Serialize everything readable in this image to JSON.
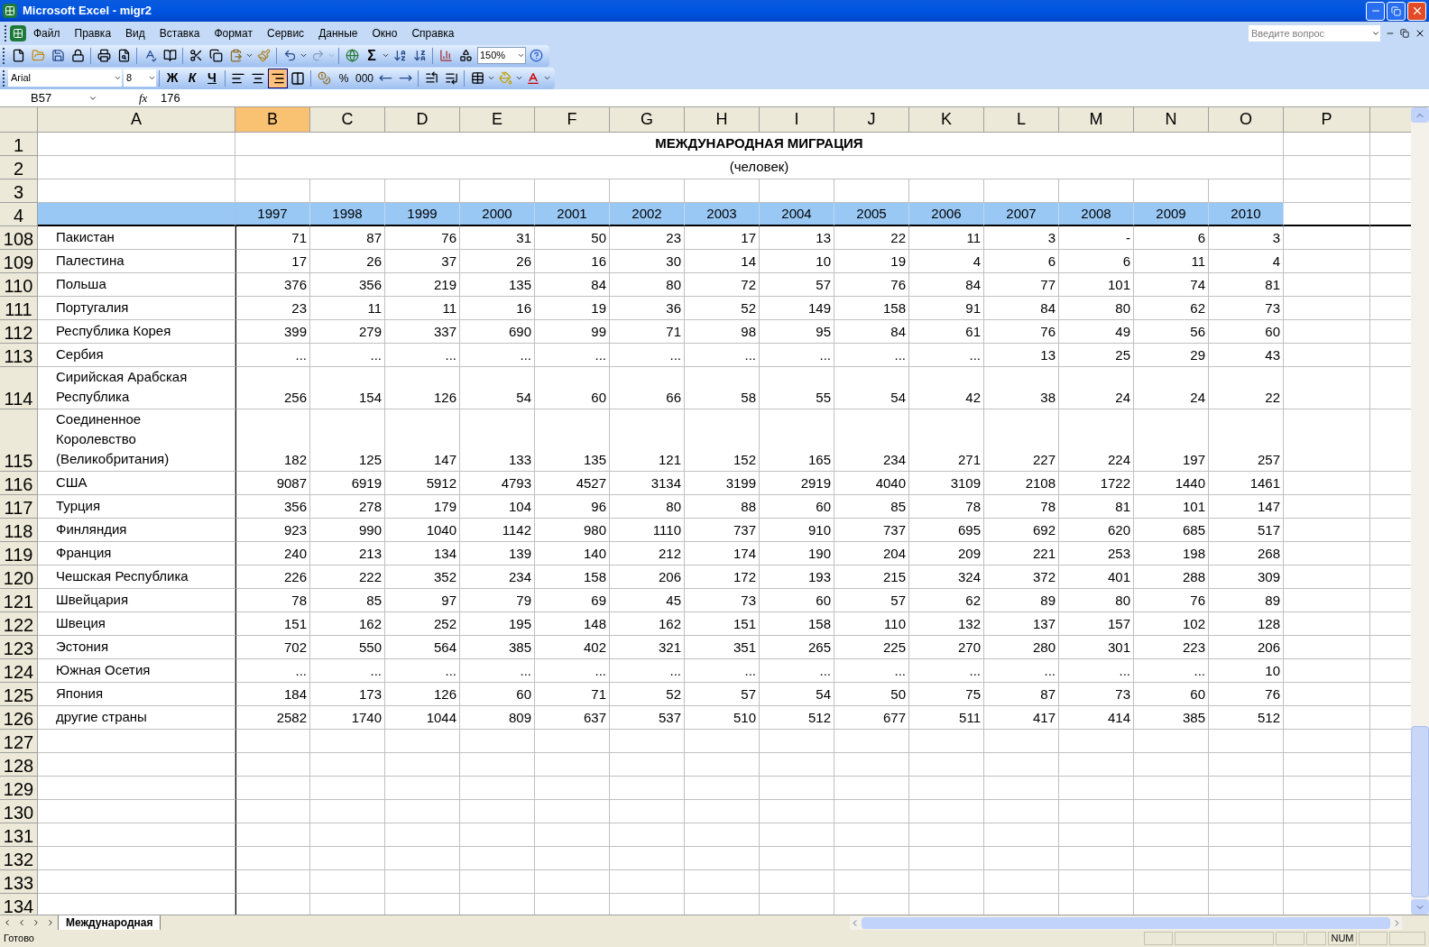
{
  "window": {
    "title": "Microsoft Excel - migr2"
  },
  "menu": [
    "Файл",
    "Правка",
    "Вид",
    "Вставка",
    "Формат",
    "Сервис",
    "Данные",
    "Окно",
    "Справка"
  ],
  "help": {
    "placeholder": "Введите вопрос"
  },
  "toolbar": {
    "sigma": "Σ",
    "zoom": "150%"
  },
  "format_bar": {
    "font": "Arial",
    "size": "8",
    "styles": [
      "Ж",
      "К",
      "Ч"
    ],
    "align": [
      {
        "kind": "left",
        "selected": false
      },
      {
        "kind": "center",
        "selected": false
      },
      {
        "kind": "right",
        "selected": true
      },
      {
        "kind": "merge",
        "selected": false
      }
    ],
    "number": [
      "%",
      "000"
    ]
  },
  "formula_bar": {
    "cell": "B57",
    "fx": "fx",
    "value": "176"
  },
  "columns": [
    {
      "label": "A",
      "selected": false
    },
    {
      "label": "B",
      "selected": true
    },
    {
      "label": "C",
      "selected": false
    },
    {
      "label": "D",
      "selected": false
    },
    {
      "label": "E",
      "selected": false
    },
    {
      "label": "F",
      "selected": false
    },
    {
      "label": "G",
      "selected": false
    },
    {
      "label": "H",
      "selected": false
    },
    {
      "label": "I",
      "selected": false
    },
    {
      "label": "J",
      "selected": false
    },
    {
      "label": "K",
      "selected": false
    },
    {
      "label": "L",
      "selected": false
    },
    {
      "label": "M",
      "selected": false
    },
    {
      "label": "N",
      "selected": false
    },
    {
      "label": "O",
      "selected": false
    },
    {
      "label": "P",
      "selected": false
    }
  ],
  "title_row": {
    "row": "1",
    "text": "МЕЖДУНАРОДНАЯ МИГРАЦИЯ"
  },
  "subtitle_row": {
    "row": "2",
    "text": "(человек)"
  },
  "blank_row": {
    "row": "3"
  },
  "year_row": {
    "row": "4",
    "years": [
      "1997",
      "1998",
      "1999",
      "2000",
      "2001",
      "2002",
      "2003",
      "2004",
      "2005",
      "2006",
      "2007",
      "2008",
      "2009",
      "2010"
    ]
  },
  "rows": [
    {
      "row": "108",
      "name": "Пакистан",
      "values": [
        "71",
        "87",
        "76",
        "31",
        "50",
        "23",
        "17",
        "13",
        "22",
        "11",
        "3",
        "-",
        "6",
        "3"
      ]
    },
    {
      "row": "109",
      "name": "Палестина",
      "values": [
        "17",
        "26",
        "37",
        "26",
        "16",
        "30",
        "14",
        "10",
        "19",
        "4",
        "6",
        "6",
        "11",
        "4"
      ]
    },
    {
      "row": "110",
      "name": "Польша",
      "values": [
        "376",
        "356",
        "219",
        "135",
        "84",
        "80",
        "72",
        "57",
        "76",
        "84",
        "77",
        "101",
        "74",
        "81"
      ]
    },
    {
      "row": "111",
      "name": "Португалия",
      "values": [
        "23",
        "11",
        "11",
        "16",
        "19",
        "36",
        "52",
        "149",
        "158",
        "91",
        "84",
        "80",
        "62",
        "73"
      ]
    },
    {
      "row": "112",
      "name": "Республика Корея",
      "values": [
        "399",
        "279",
        "337",
        "690",
        "99",
        "71",
        "98",
        "95",
        "84",
        "61",
        "76",
        "49",
        "56",
        "60"
      ]
    },
    {
      "row": "113",
      "name": "Сербия",
      "values": [
        "...",
        "...",
        "...",
        "...",
        "...",
        "...",
        "...",
        "...",
        "...",
        "...",
        "13",
        "25",
        "29",
        "43"
      ]
    },
    {
      "row": "114",
      "name": "Сирийская Арабская Республика",
      "values": [
        "256",
        "154",
        "126",
        "54",
        "60",
        "66",
        "58",
        "55",
        "54",
        "42",
        "38",
        "24",
        "24",
        "22"
      ]
    },
    {
      "row": "115",
      "name": "Соединенное Королевство (Великобритания)",
      "values": [
        "182",
        "125",
        "147",
        "133",
        "135",
        "121",
        "152",
        "165",
        "234",
        "271",
        "227",
        "224",
        "197",
        "257"
      ]
    },
    {
      "row": "116",
      "name": "США",
      "values": [
        "9087",
        "6919",
        "5912",
        "4793",
        "4527",
        "3134",
        "3199",
        "2919",
        "4040",
        "3109",
        "2108",
        "1722",
        "1440",
        "1461"
      ]
    },
    {
      "row": "117",
      "name": "Турция",
      "values": [
        "356",
        "278",
        "179",
        "104",
        "96",
        "80",
        "88",
        "60",
        "85",
        "78",
        "78",
        "81",
        "101",
        "147"
      ]
    },
    {
      "row": "118",
      "name": "Финляндия",
      "values": [
        "923",
        "990",
        "1040",
        "1142",
        "980",
        "1110",
        "737",
        "910",
        "737",
        "695",
        "692",
        "620",
        "685",
        "517"
      ]
    },
    {
      "row": "119",
      "name": "Франция",
      "values": [
        "240",
        "213",
        "134",
        "139",
        "140",
        "212",
        "174",
        "190",
        "204",
        "209",
        "221",
        "253",
        "198",
        "268"
      ]
    },
    {
      "row": "120",
      "name": "Чешская Республика",
      "values": [
        "226",
        "222",
        "352",
        "234",
        "158",
        "206",
        "172",
        "193",
        "215",
        "324",
        "372",
        "401",
        "288",
        "309"
      ]
    },
    {
      "row": "121",
      "name": "Швейцария",
      "values": [
        "78",
        "85",
        "97",
        "79",
        "69",
        "45",
        "73",
        "60",
        "57",
        "62",
        "89",
        "80",
        "76",
        "89"
      ]
    },
    {
      "row": "122",
      "name": "Швеция",
      "values": [
        "151",
        "162",
        "252",
        "195",
        "148",
        "162",
        "151",
        "158",
        "110",
        "132",
        "137",
        "157",
        "102",
        "128"
      ]
    },
    {
      "row": "123",
      "name": "Эстония",
      "values": [
        "702",
        "550",
        "564",
        "385",
        "402",
        "321",
        "351",
        "265",
        "225",
        "270",
        "280",
        "301",
        "223",
        "206"
      ]
    },
    {
      "row": "124",
      "name": "Южная Осетия",
      "values": [
        "...",
        "...",
        "...",
        "...",
        "...",
        "...",
        "...",
        "...",
        "...",
        "...",
        "...",
        "...",
        "...",
        "10"
      ]
    },
    {
      "row": "125",
      "name": "Япония",
      "values": [
        "184",
        "173",
        "126",
        "60",
        "71",
        "52",
        "57",
        "54",
        "50",
        "75",
        "87",
        "73",
        "60",
        "76"
      ]
    },
    {
      "row": "126",
      "name": "другие страны",
      "values": [
        "2582",
        "1740",
        "1044",
        "809",
        "637",
        "537",
        "510",
        "512",
        "677",
        "511",
        "417",
        "414",
        "385",
        "512"
      ]
    }
  ],
  "empty_rows": [
    "127",
    "128",
    "129",
    "130",
    "131",
    "132",
    "133",
    "134"
  ],
  "sheet_tabs": [
    {
      "label": "Международная",
      "selected": true
    }
  ],
  "status_bar": {
    "text": "Готово",
    "indicator": "NUM"
  }
}
